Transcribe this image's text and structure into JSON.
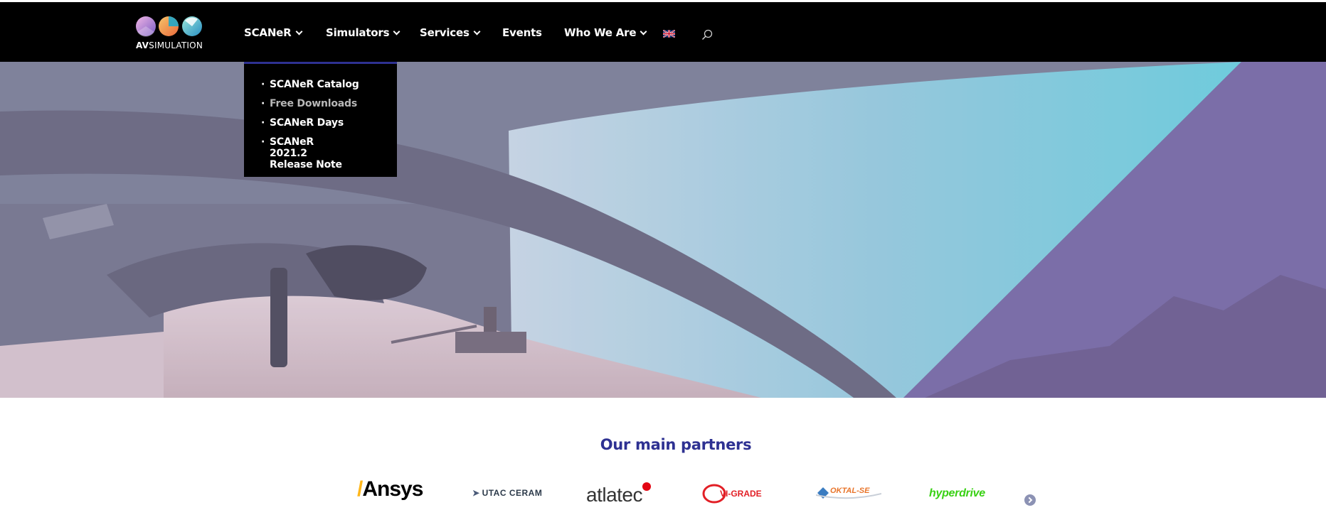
{
  "brand": {
    "logo_text_bold": "AV",
    "logo_text_rest": "SIMULATION",
    "logo_colors": [
      "#c58bd8",
      "#f0a35a",
      "#5bc6d6"
    ]
  },
  "nav": {
    "items": [
      {
        "label": "SCANeR",
        "has_dropdown": true
      },
      {
        "label": "Simulators",
        "has_dropdown": true
      },
      {
        "label": "Services",
        "has_dropdown": true
      },
      {
        "label": "Events",
        "has_dropdown": false
      },
      {
        "label": "Who We Are",
        "has_dropdown": true
      }
    ],
    "language_icon": "uk-flag-icon",
    "search_icon": "search-icon"
  },
  "dropdown": {
    "items": [
      {
        "label": "SCANeR Catalog"
      },
      {
        "label": "Free Downloads"
      },
      {
        "label": "SCANeR Days"
      },
      {
        "label": "SCANeR 2021.2 Release Note"
      }
    ]
  },
  "hero": {
    "slides_count": 3,
    "active_slide": 2
  },
  "partners": {
    "title": "Our main partners",
    "logos": [
      "Ansys",
      "UTAC CERAM",
      "atlatec",
      "VI-GRADE",
      "OKTAL-SE",
      "hyperdrive"
    ]
  },
  "colors": {
    "header_bg": "#000000",
    "accent": "#2e3192",
    "hero_cyan": "#5fd3e0",
    "hero_purple": "#6b5b9a"
  }
}
